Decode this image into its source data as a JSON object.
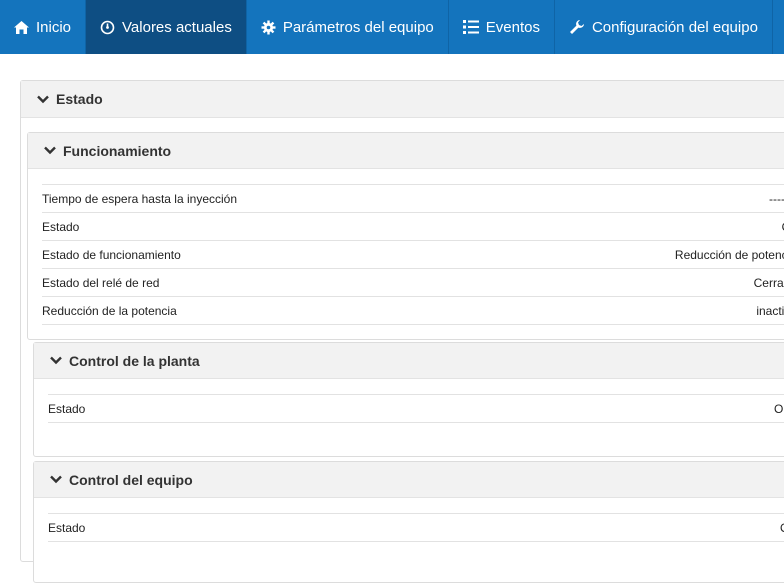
{
  "nav": {
    "items": [
      {
        "label": "Inicio",
        "icon": "home-icon"
      },
      {
        "label": "Valores actuales",
        "icon": "gauge-icon"
      },
      {
        "label": "Parámetros del equipo",
        "icon": "gear-icon"
      },
      {
        "label": "Eventos",
        "icon": "list-icon"
      },
      {
        "label": "Configuración del equipo",
        "icon": "wrench-icon"
      }
    ],
    "active_index": 1,
    "colors": {
      "bar": "#1474bd",
      "active": "#0e4e83"
    }
  },
  "estado": {
    "title": "Estado",
    "funcionamiento": {
      "title": "Funcionamiento",
      "rows": [
        {
          "label": "Tiempo de espera hasta la inyección",
          "value": "-------"
        },
        {
          "label": "Estado",
          "value": "Ok"
        },
        {
          "label": "Estado de funcionamiento",
          "value": "Reducción de potencia"
        },
        {
          "label": "Estado del relé de red",
          "value": "Cerrado"
        },
        {
          "label": "Reducción de la potencia",
          "value": "inactivo"
        }
      ]
    },
    "control_planta": {
      "title": "Control de la planta",
      "rows": [
        {
          "label": "Estado",
          "value": "OFF"
        }
      ]
    },
    "control_equipo": {
      "title": "Control del equipo",
      "rows": [
        {
          "label": "Estado",
          "value": "ON"
        }
      ]
    }
  }
}
